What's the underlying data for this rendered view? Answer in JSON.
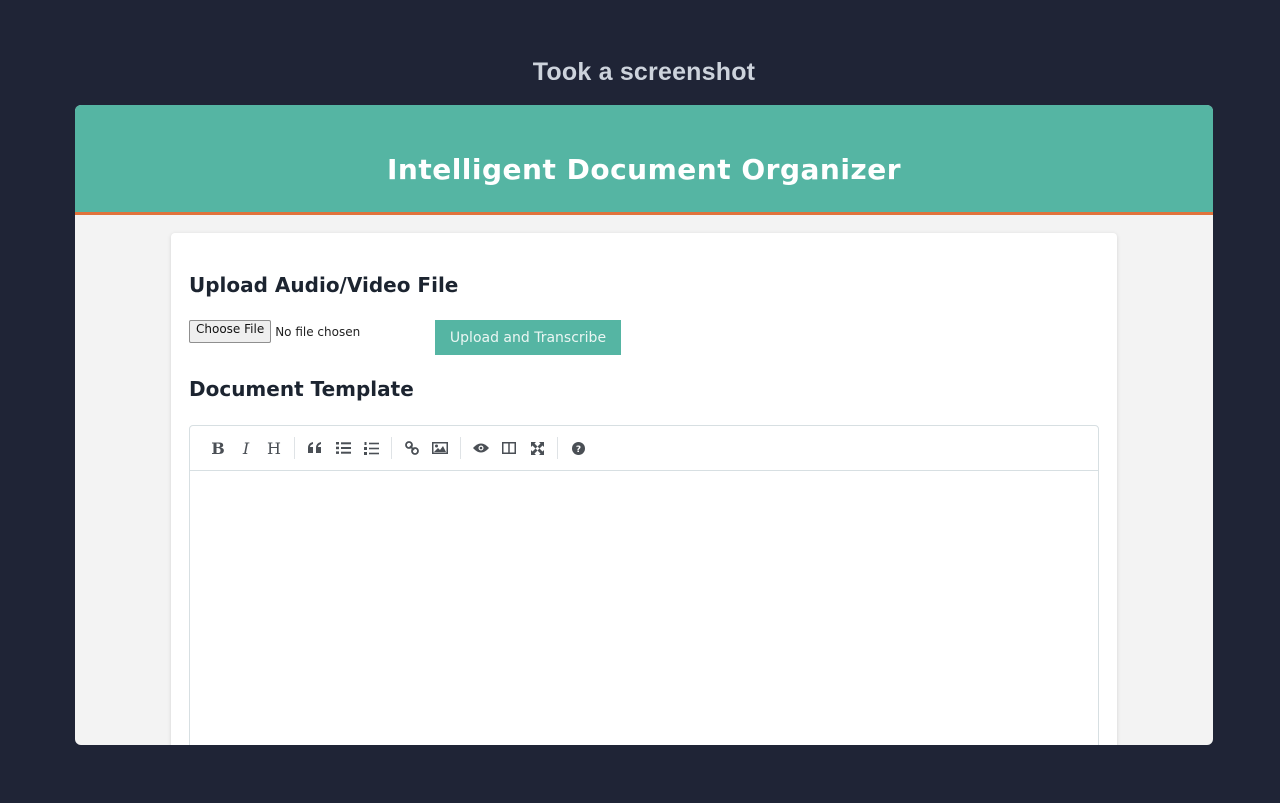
{
  "caption": "Took a screenshot",
  "app": {
    "title": "Intelligent Document Organizer",
    "header_color": "#55b5a3",
    "accent_border_color": "#e0733c"
  },
  "upload_section": {
    "heading": "Upload Audio/Video File",
    "choose_file_label": "Choose File",
    "file_status": "No file chosen",
    "upload_button_label": "Upload and Transcribe"
  },
  "template_section": {
    "heading": "Document Template",
    "editor_value": "",
    "toolbar": {
      "bold_label": "B",
      "italic_label": "I",
      "heading_label": "H",
      "icons": [
        "bold-icon",
        "italic-icon",
        "heading-icon",
        "quote-icon",
        "unordered-list-icon",
        "ordered-list-icon",
        "link-icon",
        "image-icon",
        "preview-icon",
        "side-by-side-icon",
        "fullscreen-icon",
        "help-icon"
      ]
    }
  }
}
